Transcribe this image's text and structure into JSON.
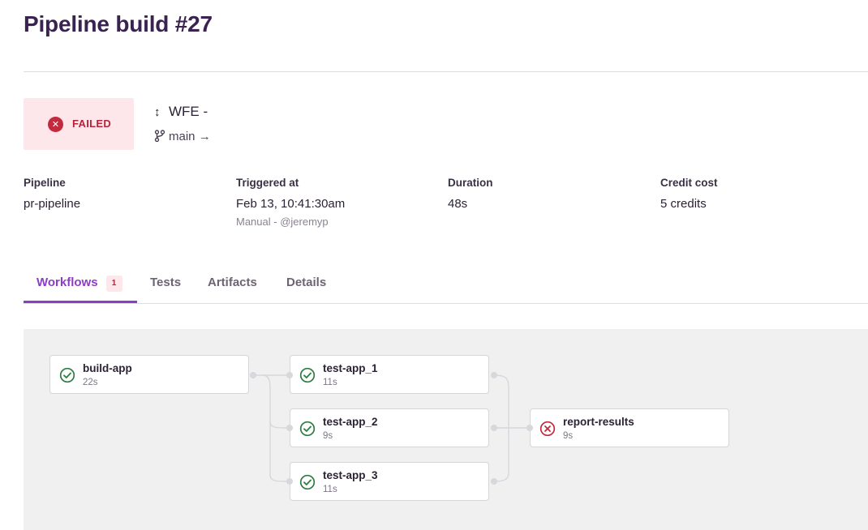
{
  "page": {
    "title": "Pipeline build #27"
  },
  "status": {
    "label": "FAILED",
    "icon": "x-circle-icon",
    "color": "#c42a3e"
  },
  "commit": {
    "text": "WFE - ",
    "icon": "commit-arrow-icon"
  },
  "branch": {
    "name": "main",
    "arrow": "→",
    "icon": "branch-icon"
  },
  "meta": {
    "pipeline": {
      "label": "Pipeline",
      "value": "pr-pipeline"
    },
    "triggered": {
      "label": "Triggered at",
      "value": "Feb 13, 10:41:30am",
      "sub": "Manual - @jeremyp"
    },
    "duration": {
      "label": "Duration",
      "value": "48s"
    },
    "credit": {
      "label": "Credit cost",
      "value": "5 credits"
    }
  },
  "tabs": [
    {
      "label": "Workflows",
      "badge": "1",
      "active": true
    },
    {
      "label": "Tests"
    },
    {
      "label": "Artifacts"
    },
    {
      "label": "Details"
    }
  ],
  "jobs": [
    {
      "name": "build-app",
      "time": "22s",
      "status": "success"
    },
    {
      "name": "test-app_1",
      "time": "11s",
      "status": "success"
    },
    {
      "name": "test-app_2",
      "time": "9s",
      "status": "success"
    },
    {
      "name": "test-app_3",
      "time": "11s",
      "status": "success"
    },
    {
      "name": "report-results",
      "time": "9s",
      "status": "failed"
    }
  ],
  "colors": {
    "accent": "#8b3dc6",
    "success": "#2e7d42",
    "failed": "#c42a3e",
    "failed_bg": "#fde7ea"
  }
}
